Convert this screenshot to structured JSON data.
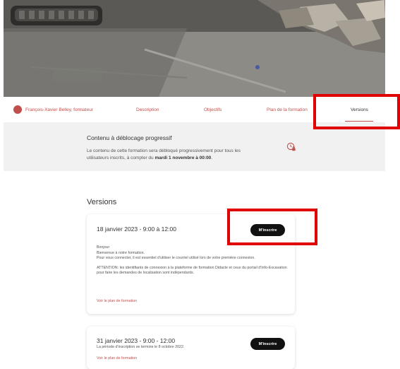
{
  "colors": {
    "accent": "#c0504d",
    "highlight_box": "#e00000",
    "banner_bg": "#f1f1f1",
    "button_bg": "#111111"
  },
  "nav": {
    "trainer": "François-Xavier Belley, formateur",
    "tabs": [
      {
        "label": "Description"
      },
      {
        "label": "Objectifs"
      },
      {
        "label": "Plan de la formation"
      },
      {
        "label": "Versions",
        "active": true
      }
    ]
  },
  "banner": {
    "title": "Contenu à déblocage progressif",
    "desc_prefix": "Le contenu de cette formation sera débloqué progressivement pour tous les utilisateurs inscrits, à compter du ",
    "desc_date": "mardi 1 novembre à 00:00",
    "desc_suffix": ".",
    "icon": "clock-lock-icon"
  },
  "versions": {
    "title": "Versions",
    "items": [
      {
        "date": "18 janvier 2023 - 9:00 à 12:00",
        "button": "M'inscrire",
        "body": [
          "Bonjour",
          "Bienvenue à notre formation.",
          "Pour vous connecter, il est essentiel d'utiliser le courriel utilisé lors de votre première connexion.",
          "ATTENTION: les identifiants de connexion à la plateforme de formation Didacte et ceux du portail d'Info-Excavation pour faire les demandes de localisation sont indépendants."
        ],
        "link": "Voir le plan de formation"
      },
      {
        "date": "31 janvier 2023 - 9:00 - 12:00",
        "button": "M'inscrire",
        "note": "La période d'inscription se termine le 8 octobre 2022.",
        "link": "Voir le plan de formation"
      }
    ]
  }
}
